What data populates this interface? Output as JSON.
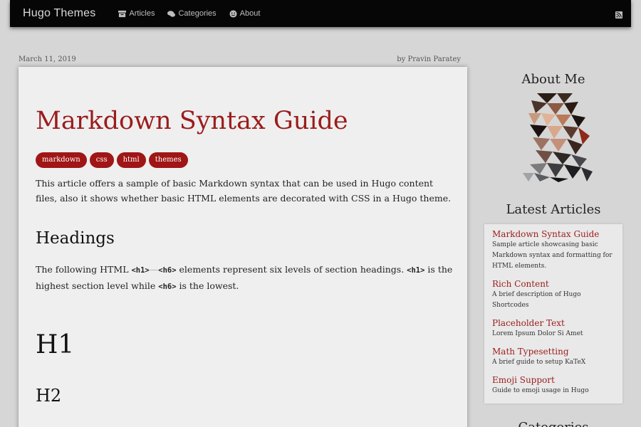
{
  "nav": {
    "brand": "Hugo Themes",
    "links": [
      {
        "label": "Articles",
        "icon": "archive-icon"
      },
      {
        "label": "Categories",
        "icon": "comments-icon"
      },
      {
        "label": "About",
        "icon": "smile-icon"
      }
    ],
    "rss_icon": "rss-icon"
  },
  "article": {
    "date": "March 11, 2019",
    "author": "by Pravin Paratey",
    "title": "Markdown Syntax Guide",
    "tags": [
      "markdown",
      "css",
      "html",
      "themes"
    ],
    "intro": "This article offers a sample of basic Markdown syntax that can be used in Hugo content files, also it shows whether basic HTML elements are decorated with CSS in a Hugo theme.",
    "section_heading": "Headings",
    "headings_desc_1": "The following HTML ",
    "code_h1": "<h1>",
    "dash": "—",
    "code_h6": "<h6>",
    "headings_desc_2": " elements represent six levels of section headings. ",
    "code_h1b": "<h1>",
    "headings_desc_3": " is the highest section level while ",
    "code_h6b": "<h6>",
    "headings_desc_4": " is the lowest.",
    "h1_demo": "H1",
    "h2_demo": "H2"
  },
  "sidebar": {
    "about_heading": "About Me",
    "latest_heading": "Latest Articles",
    "next_heading": "Categories",
    "latest": [
      {
        "title": "Markdown Syntax Guide",
        "desc": "Sample article showcasing basic Markdown syntax and formatting for HTML elements."
      },
      {
        "title": "Rich Content",
        "desc": "A brief description of Hugo Shortcodes"
      },
      {
        "title": "Placeholder Text",
        "desc": "Lorem Ipsum Dolor Si Amet"
      },
      {
        "title": "Math Typesetting",
        "desc": "A brief guide to setup KaTeX"
      },
      {
        "title": "Emoji Support",
        "desc": "Guide to emoji usage in Hugo"
      }
    ]
  },
  "colors": {
    "accent": "#9b1c1c",
    "tag_bg": "#a01515",
    "navbar": "#060606"
  }
}
